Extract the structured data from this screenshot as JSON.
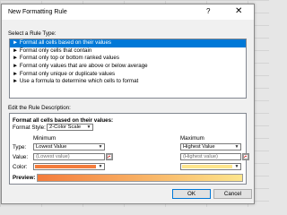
{
  "dialog": {
    "title": "New Formatting Rule",
    "help": "?",
    "close": "✕"
  },
  "rule_type": {
    "label": "Select a Rule Type:",
    "items": [
      "► Format all cells based on their values",
      "► Format only cells that contain",
      "► Format only top or bottom ranked values",
      "► Format only values that are above or below average",
      "► Format only unique or duplicate values",
      "► Use a formula to determine which cells to format"
    ],
    "selected_index": 0
  },
  "description": {
    "label": "Edit the Rule Description:",
    "heading": "Format all cells based on their values:",
    "format_style_label": "Format Style:",
    "format_style_value": "2-Color Scale",
    "minimum_label": "Minimum",
    "maximum_label": "Maximum",
    "type_label": "Type:",
    "value_label": "Value:",
    "color_label": "Color:",
    "min_type": "Lowest Value",
    "max_type": "Highest Value",
    "min_value": "(Lowest value)",
    "max_value": "(Highest value)",
    "min_color": "#f47c3c",
    "max_color": "#fde58c",
    "preview_label": "Preview:"
  },
  "buttons": {
    "ok": "OK",
    "cancel": "Cancel"
  },
  "colors": {
    "selection": "#0078d7",
    "dialog_bg": "#f0f0f0"
  }
}
